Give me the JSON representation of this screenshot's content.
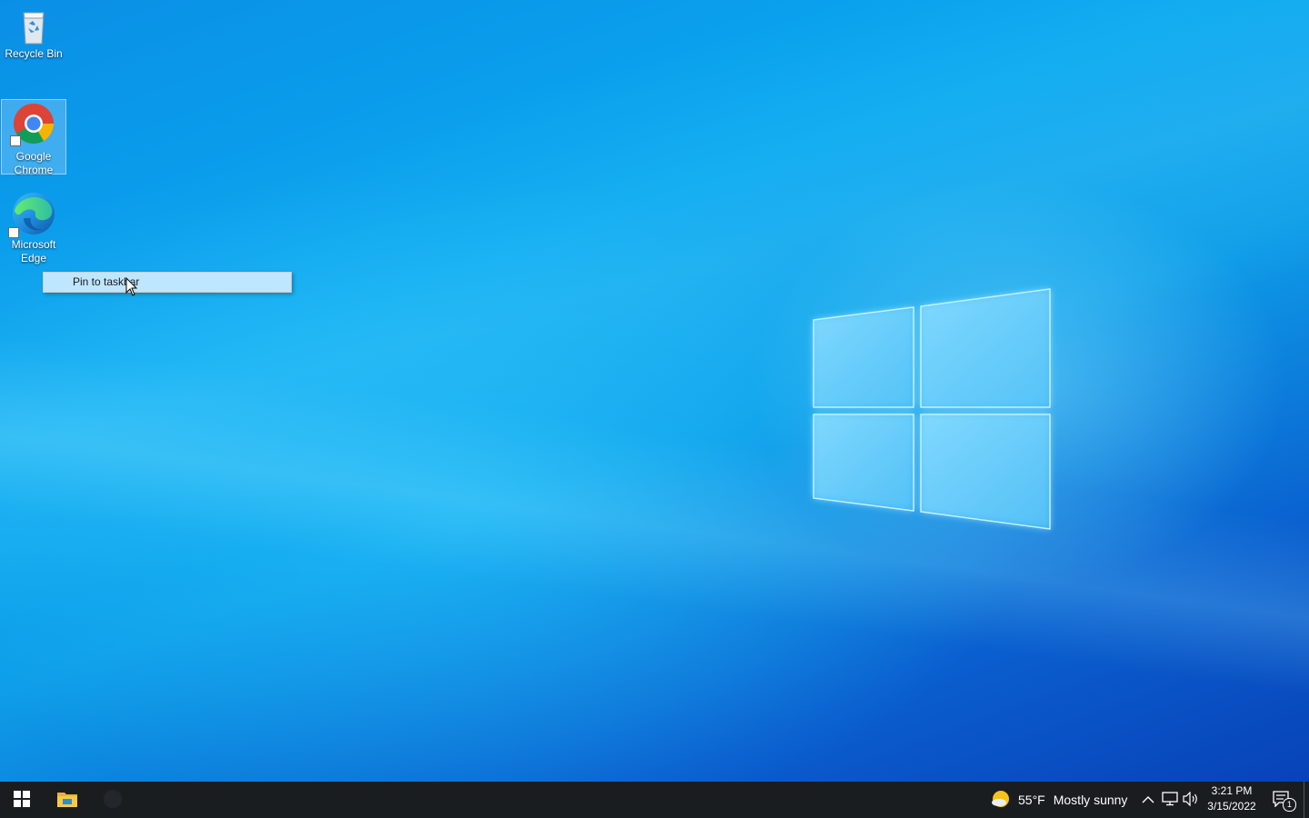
{
  "desktop": {
    "icons": [
      {
        "label": "Recycle Bin"
      },
      {
        "label": "Google Chrome"
      },
      {
        "label": "Microsoft Edge"
      }
    ]
  },
  "context_menu": {
    "items": [
      {
        "label": "Pin to taskbar"
      }
    ]
  },
  "taskbar": {
    "start_icon": "windows-logo-icon",
    "pinned": [
      {
        "name": "file-explorer-icon"
      },
      {
        "name": "app-icon"
      }
    ],
    "weather": {
      "icon": "partly-sunny-icon",
      "temperature": "55°F",
      "condition": "Mostly sunny"
    },
    "tray": {
      "chevron_icon": "chevron-up-icon",
      "network_icon": "network-icon",
      "volume_icon": "volume-icon"
    },
    "clock": {
      "time": "3:21 PM",
      "date": "3/15/2022"
    },
    "notifications": {
      "icon": "action-center-icon",
      "count": "1"
    }
  },
  "colors": {
    "taskbar_bg": "#1a1d20",
    "menu_highlight": "#bfe6ff",
    "wallpaper_primary": "#0aa8f0"
  }
}
